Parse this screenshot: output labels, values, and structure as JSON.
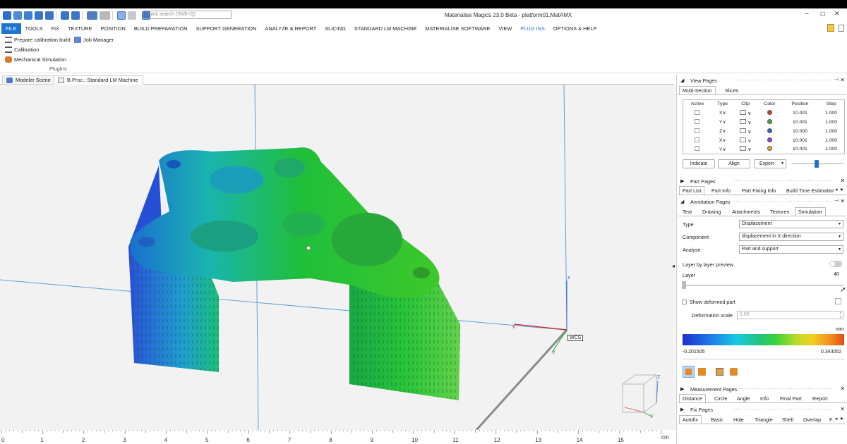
{
  "app": {
    "title": "Materialise Magics 23.0 Beta - platform01.MatAMX",
    "search_placeholder": "Quick search (Shift+Q)",
    "win_min": "–",
    "win_restore": "▢",
    "win_close": "✕"
  },
  "menu": [
    "FILE",
    "TOOLS",
    "FIX",
    "TEXTURE",
    "POSITION",
    "BUILD PREPARATION",
    "SUPPORT GENERATION",
    "ANALYZE & REPORT",
    "SLICING",
    "STANDARD LM MACHINE",
    "MATERIALISE SOFTWARE",
    "VIEW",
    "PLUG INS",
    "OPTIONS & HELP"
  ],
  "menu_active": "PLUG INS",
  "ribbon": {
    "prepare": "Prepare calibration build",
    "job_manager": "Job Manager",
    "calibration": "Calibration",
    "mech_sim": "Mechanical Simulation",
    "group": "PlugIns"
  },
  "doc_tabs": [
    "Modeler Scene",
    "B.Proc.: Standard LM Machine"
  ],
  "viewport": {
    "wcs": "WCS",
    "axis_z": "z",
    "axis_x": "x",
    "axis_y": "y",
    "cube_z": "Z",
    "cube_y": "Y",
    "ruler_ticks": [
      "0",
      "1",
      "2",
      "3",
      "4",
      "5",
      "6",
      "7",
      "8",
      "9",
      "10",
      "11",
      "12",
      "13",
      "14",
      "15"
    ],
    "ruler_unit": "cm"
  },
  "view_pages": {
    "title": "View Pages",
    "tabs": [
      "Multi-Section",
      "Slices"
    ],
    "headers": [
      "Active",
      "Type",
      "Clip",
      "Color",
      "Position",
      "Step"
    ],
    "rows": [
      {
        "type": "X∨",
        "color": "#e03a2f",
        "position": "10.001",
        "step": "1.000"
      },
      {
        "type": "Y∨",
        "color": "#3aa83a",
        "position": "10.001",
        "step": "1.000"
      },
      {
        "type": "Z∨",
        "color": "#2f62d0",
        "position": "10.000",
        "step": "1.000"
      },
      {
        "type": "X∨",
        "color": "#9b3ad0",
        "position": "10.001",
        "step": "1.000"
      },
      {
        "type": "Y∨",
        "color": "#f0a020",
        "position": "10.001",
        "step": "1.000"
      }
    ],
    "buttons": [
      "Indicate",
      "Align",
      "Export"
    ]
  },
  "part_pages": {
    "title": "Part Pages",
    "tabs": [
      "Part List",
      "Part Info",
      "Part Fixing Info",
      "Build Time Estimation"
    ]
  },
  "annotation_pages": {
    "title": "Annotation Pages",
    "tabs": [
      "Text",
      "Drawing",
      "Attachments",
      "Textures",
      "Simulation"
    ],
    "type_label": "Type",
    "type_value": "Displacement",
    "component_label": "Component",
    "component_value": "displacement in X direction",
    "analyse_label": "Analyse",
    "analyse_value": "Part and support",
    "layer_preview": "Layer by layer preview",
    "layer_label": "Layer",
    "layer_value": "48",
    "show_deformed": "Show deformed part",
    "deform_label": "Deformation scale",
    "deform_value": "1.00",
    "unit": "mm",
    "min": "-0.201505",
    "max": "0.343052"
  },
  "measurement_pages": {
    "title": "Measurement Pages",
    "tabs": [
      "Distance",
      "Circle",
      "Angle",
      "Info",
      "Final Part",
      "Report"
    ]
  },
  "fix_pages": {
    "title": "Fix Pages",
    "tabs": [
      "Autofix",
      "Basic",
      "Hole",
      "Triangle",
      "Shell",
      "Overlap",
      "F"
    ]
  }
}
